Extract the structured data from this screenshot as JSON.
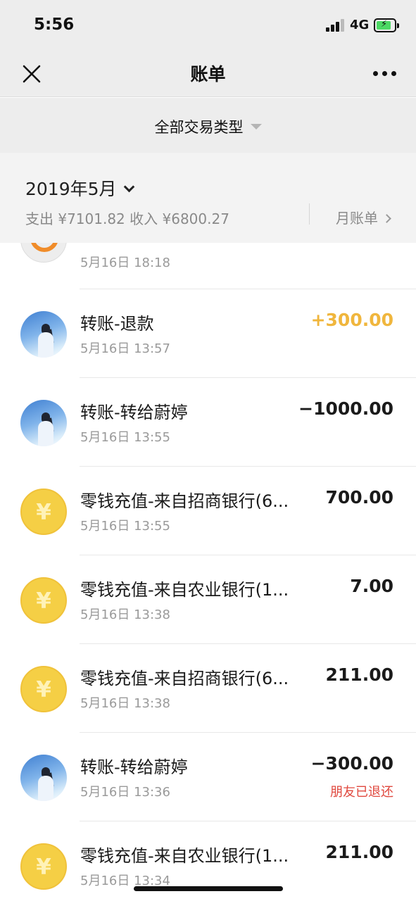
{
  "status_bar": {
    "time": "5:56",
    "network": "4G"
  },
  "nav": {
    "title": "账单"
  },
  "filter": {
    "label": "全部交易类型"
  },
  "month": {
    "label": "2019年5月",
    "summary": "支出 ¥7101.82 收入 ¥6800.27",
    "monthly_bill": "月账单"
  },
  "transactions": [
    {
      "title": "",
      "time": "5月16日 18:18",
      "amount": "",
      "status": "",
      "avatar": "ring-icon"
    },
    {
      "title": "转账-退款",
      "time": "5月16日 13:57",
      "amount": "+300.00",
      "status": "",
      "avatar": "photo",
      "type": "income"
    },
    {
      "title": "转账-转给蔚婷",
      "time": "5月16日 13:55",
      "amount": "−1000.00",
      "status": "",
      "avatar": "photo"
    },
    {
      "title": "零钱充值-来自招商银行(6...",
      "time": "5月16日 13:55",
      "amount": "700.00",
      "status": "",
      "avatar": "yen-coin-icon"
    },
    {
      "title": "零钱充值-来自农业银行(1...",
      "time": "5月16日 13:38",
      "amount": "7.00",
      "status": "",
      "avatar": "yen-coin-icon"
    },
    {
      "title": "零钱充值-来自招商银行(6...",
      "time": "5月16日 13:38",
      "amount": "211.00",
      "status": "",
      "avatar": "yen-coin-icon"
    },
    {
      "title": "转账-转给蔚婷",
      "time": "5月16日 13:36",
      "amount": "−300.00",
      "status": "朋友已退还",
      "avatar": "photo"
    },
    {
      "title": "零钱充值-来自农业银行(1...",
      "time": "5月16日 13:34",
      "amount": "211.00",
      "status": "",
      "avatar": "yen-coin-icon"
    }
  ],
  "colors": {
    "income": "#f0b63d",
    "refund_status": "#e0483e",
    "coin": "#f5cf45",
    "header_bg": "#ededed"
  }
}
